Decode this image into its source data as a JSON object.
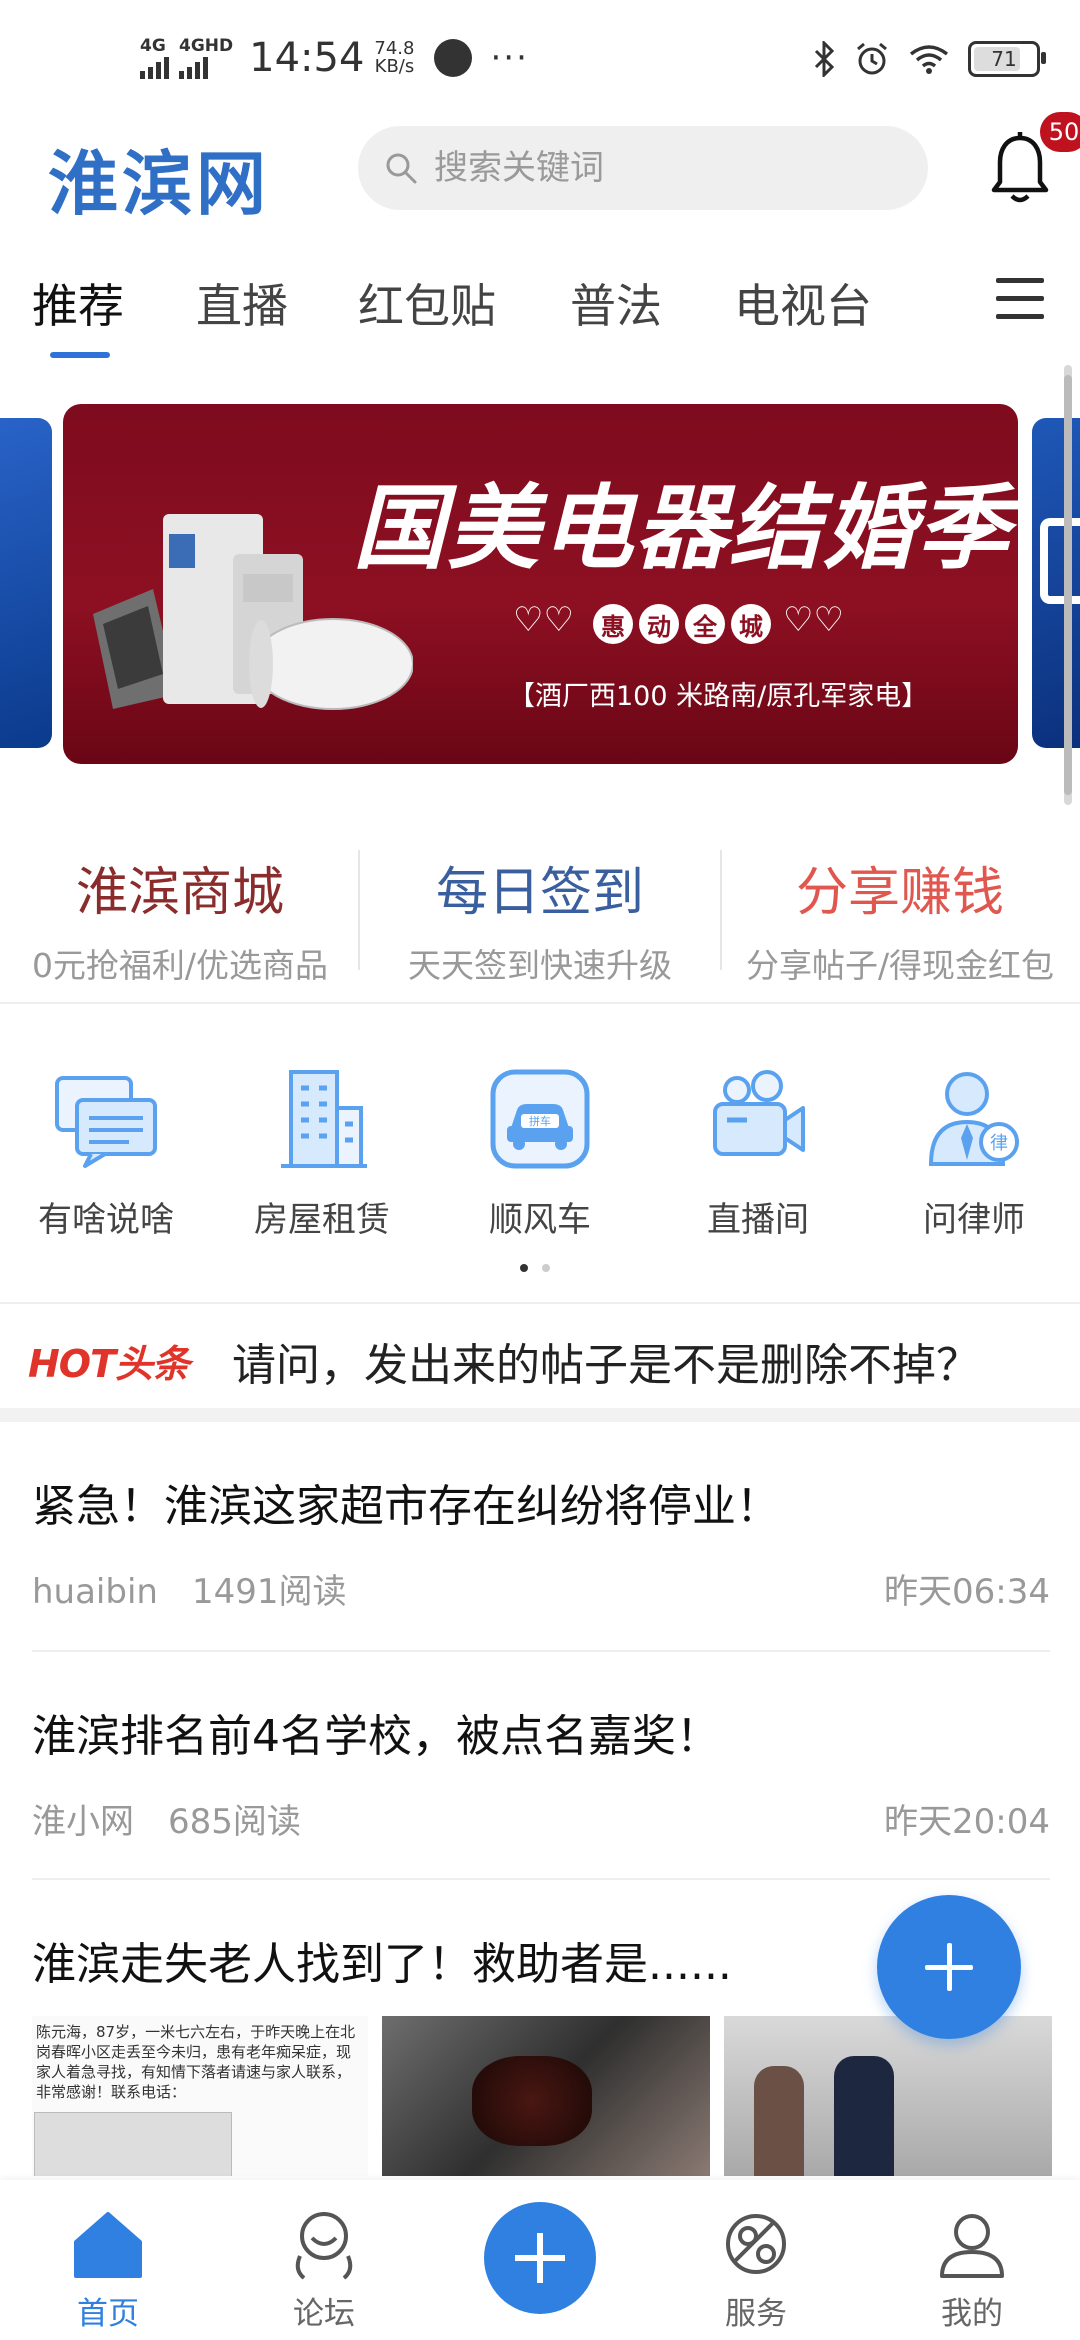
{
  "status_bar": {
    "net1": "4G",
    "net2": "4GHD",
    "time": "14:54",
    "speed_value": "74.8",
    "speed_unit": "KB/s",
    "battery": "71"
  },
  "header": {
    "logo": "淮滨网",
    "search_placeholder": "搜索关键词",
    "notification_count": "50"
  },
  "tabs": [
    {
      "label": "推荐"
    },
    {
      "label": "直播"
    },
    {
      "label": "红包贴"
    },
    {
      "label": "普法"
    },
    {
      "label": "电视台"
    }
  ],
  "banner": {
    "title": "国美电器结婚季",
    "tag_chars": [
      "惠",
      "动",
      "全",
      "城"
    ],
    "address": "【酒厂西100 米路南/原孔军家电】"
  },
  "features": [
    {
      "title": "淮滨商城",
      "subtitle": "0元抢福利/优选商品",
      "color": "#8b2c2c"
    },
    {
      "title": "每日签到",
      "subtitle": "天天签到快速升级",
      "color": "#3a5f9e"
    },
    {
      "title": "分享赚钱",
      "subtitle": "分享帖子/得现金红包",
      "color": "#e0574f"
    }
  ],
  "quick_icons": [
    {
      "label": "有啥说啥",
      "icon": "chat-bubbles-icon"
    },
    {
      "label": "房屋租赁",
      "icon": "buildings-icon"
    },
    {
      "label": "顺风车",
      "icon": "carpool-icon",
      "badge_text": "拼车"
    },
    {
      "label": "直播间",
      "icon": "video-camera-icon"
    },
    {
      "label": "问律师",
      "icon": "lawyer-icon",
      "badge_text": "律"
    }
  ],
  "hot": {
    "logo": "HOT头条",
    "text": "请问，发出来的帖子是不是删除不掉？"
  },
  "news": [
    {
      "title": "紧急！淮滨这家超市存在纠纷将停业！",
      "author": "huaibin",
      "reads": "1491阅读",
      "time": "昨天06:34"
    },
    {
      "title": "淮滨排名前4名学校，被点名嘉奖！",
      "author": "淮小网",
      "reads": "685阅读",
      "time": "昨天20:04"
    },
    {
      "title": "淮滨走失老人找到了！救助者是......",
      "thumb_text": "陈元海，87岁，一米七六左右，于昨天晚上在北岗春晖小区走丢至今未归，患有老年痴呆症，现家人着急寻找，有知情下落者请速与家人联系，非常感谢！联系电话："
    }
  ],
  "bottom_nav": [
    {
      "label": "首页",
      "icon": "home-icon"
    },
    {
      "label": "论坛",
      "icon": "forum-icon"
    },
    {
      "label": "",
      "icon": "add-icon"
    },
    {
      "label": "服务",
      "icon": "service-icon"
    },
    {
      "label": "我的",
      "icon": "profile-icon"
    }
  ],
  "colors": {
    "accent": "#2f80e0",
    "logo": "#2f6fc6",
    "badge": "#c0121e",
    "banner_bg": "#8d1022",
    "hot": "#e0342b"
  }
}
